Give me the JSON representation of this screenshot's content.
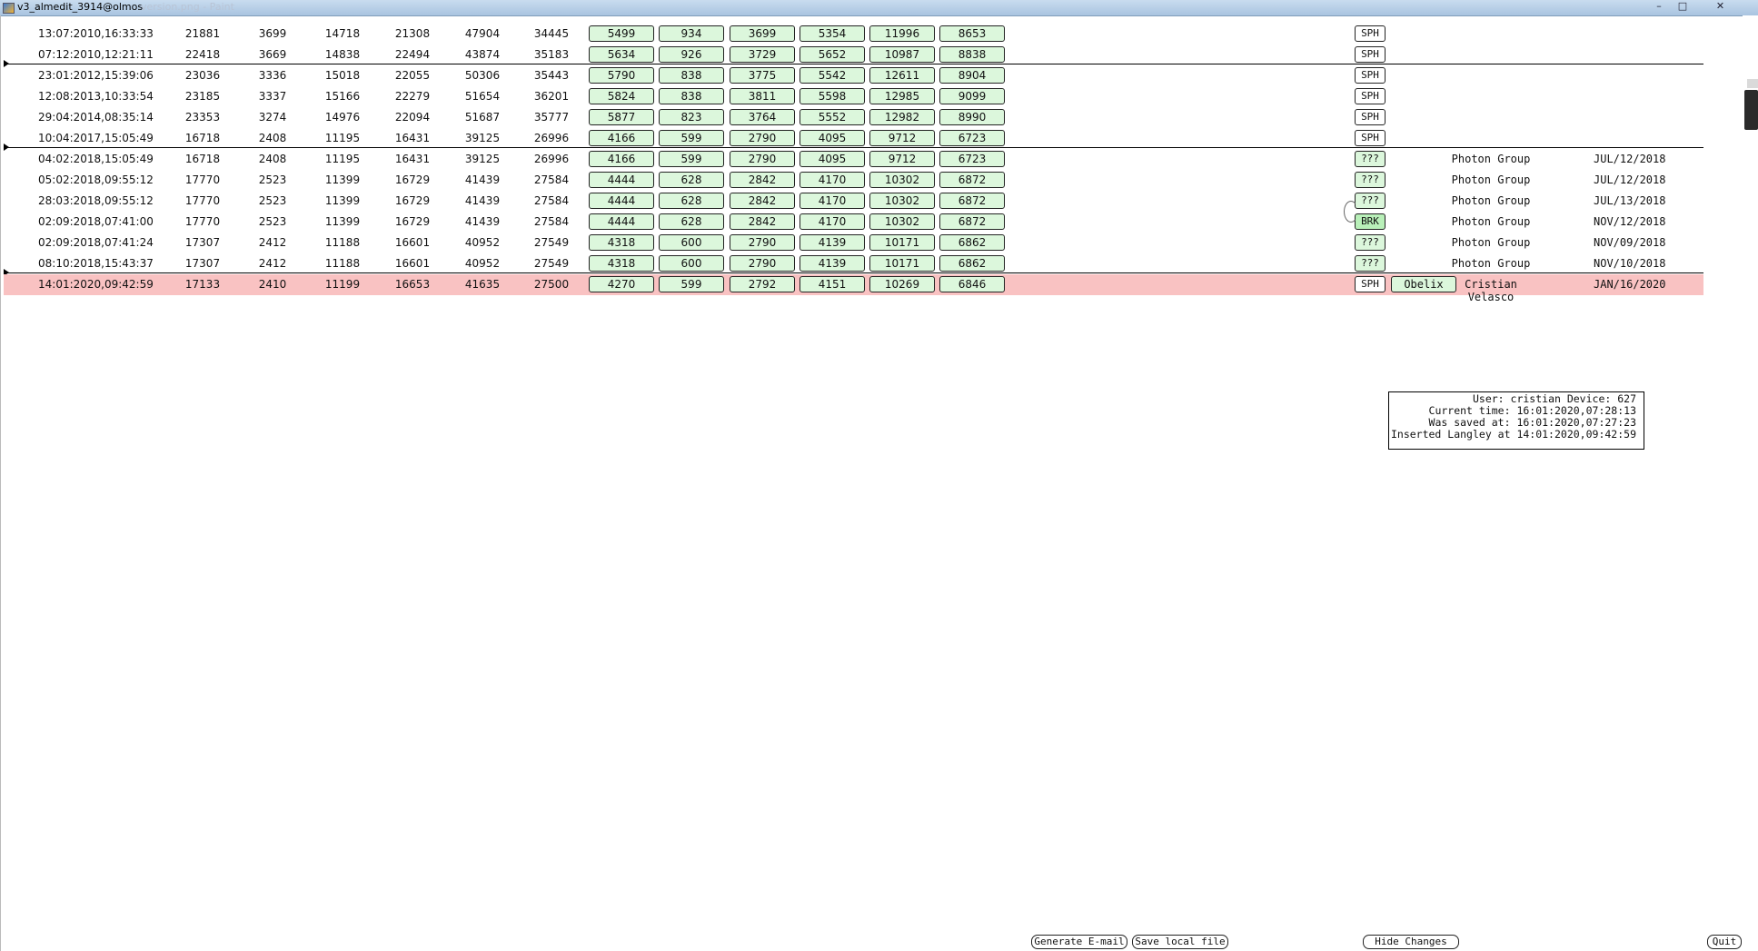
{
  "window": {
    "title": "v3_almedit_3914@olmos",
    "faded_title": "version.png - Paint",
    "buttons": [
      "–",
      "□",
      "✕"
    ]
  },
  "rows": [
    {
      "date": "13:07:2010,16:33:33",
      "nums": [
        "21881",
        "3699",
        "14718",
        "21308",
        "47904",
        "34445"
      ],
      "boxes": [
        "5499",
        "934",
        "3699",
        "5354",
        "11996",
        "8653"
      ],
      "status": "SPH",
      "group": "",
      "pdate": "",
      "sep_before": false
    },
    {
      "date": "07:12:2010,12:21:11",
      "nums": [
        "22418",
        "3669",
        "14838",
        "22494",
        "43874",
        "35183"
      ],
      "boxes": [
        "5634",
        "926",
        "3729",
        "5652",
        "10987",
        "8838"
      ],
      "status": "SPH",
      "group": "",
      "pdate": "",
      "sep_before": false
    },
    {
      "date": "23:01:2012,15:39:06",
      "nums": [
        "23036",
        "3336",
        "15018",
        "22055",
        "50306",
        "35443"
      ],
      "boxes": [
        "5790",
        "838",
        "3775",
        "5542",
        "12611",
        "8904"
      ],
      "status": "SPH",
      "group": "",
      "pdate": "",
      "sep_before": true
    },
    {
      "date": "12:08:2013,10:33:54",
      "nums": [
        "23185",
        "3337",
        "15166",
        "22279",
        "51654",
        "36201"
      ],
      "boxes": [
        "5824",
        "838",
        "3811",
        "5598",
        "12985",
        "9099"
      ],
      "status": "SPH",
      "group": "",
      "pdate": "",
      "sep_before": false
    },
    {
      "date": "29:04:2014,08:35:14",
      "nums": [
        "23353",
        "3274",
        "14976",
        "22094",
        "51687",
        "35777"
      ],
      "boxes": [
        "5877",
        "823",
        "3764",
        "5552",
        "12982",
        "8990"
      ],
      "status": "SPH",
      "group": "",
      "pdate": "",
      "sep_before": false
    },
    {
      "date": "10:04:2017,15:05:49",
      "nums": [
        "16718",
        "2408",
        "11195",
        "16431",
        "39125",
        "26996"
      ],
      "boxes": [
        "4166",
        "599",
        "2790",
        "4095",
        "9712",
        "6723"
      ],
      "status": "SPH",
      "group": "",
      "pdate": "",
      "sep_before": false
    },
    {
      "date": "04:02:2018,15:05:49",
      "nums": [
        "16718",
        "2408",
        "11195",
        "16431",
        "39125",
        "26996"
      ],
      "boxes": [
        "4166",
        "599",
        "2790",
        "4095",
        "9712",
        "6723"
      ],
      "status": "???",
      "group": "Photon Group",
      "pdate": "JUL/12/2018",
      "sep_before": true
    },
    {
      "date": "05:02:2018,09:55:12",
      "nums": [
        "17770",
        "2523",
        "11399",
        "16729",
        "41439",
        "27584"
      ],
      "boxes": [
        "4444",
        "628",
        "2842",
        "4170",
        "10302",
        "6872"
      ],
      "status": "???",
      "group": "Photon Group",
      "pdate": "JUL/12/2018",
      "sep_before": false
    },
    {
      "date": "28:03:2018,09:55:12",
      "nums": [
        "17770",
        "2523",
        "11399",
        "16729",
        "41439",
        "27584"
      ],
      "boxes": [
        "4444",
        "628",
        "2842",
        "4170",
        "10302",
        "6872"
      ],
      "status": "???",
      "group": "Photon Group",
      "pdate": "JUL/13/2018",
      "sep_before": false
    },
    {
      "date": "02:09:2018,07:41:00",
      "nums": [
        "17770",
        "2523",
        "11399",
        "16729",
        "41439",
        "27584"
      ],
      "boxes": [
        "4444",
        "628",
        "2842",
        "4170",
        "10302",
        "6872"
      ],
      "status": "BRK",
      "group": "Photon Group",
      "pdate": "NOV/12/2018",
      "sep_before": false
    },
    {
      "date": "02:09:2018,07:41:24",
      "nums": [
        "17307",
        "2412",
        "11188",
        "16601",
        "40952",
        "27549"
      ],
      "boxes": [
        "4318",
        "600",
        "2790",
        "4139",
        "10171",
        "6862"
      ],
      "status": "???",
      "group": "Photon Group",
      "pdate": "NOV/09/2018",
      "sep_before": false
    },
    {
      "date": "08:10:2018,15:43:37",
      "nums": [
        "17307",
        "2412",
        "11188",
        "16601",
        "40952",
        "27549"
      ],
      "boxes": [
        "4318",
        "600",
        "2790",
        "4139",
        "10171",
        "6862"
      ],
      "status": "???",
      "group": "Photon Group",
      "pdate": "NOV/10/2018",
      "sep_before": false
    },
    {
      "date": "14:01:2020,09:42:59",
      "nums": [
        "17133",
        "2410",
        "11199",
        "16653",
        "41635",
        "27500"
      ],
      "boxes": [
        "4270",
        "599",
        "2792",
        "4151",
        "10269",
        "6846"
      ],
      "status": "SPH",
      "obelix": "Obelix",
      "group": "Cristian Velasco",
      "pdate": "JAN/16/2020",
      "sep_before": true,
      "highlight": true
    }
  ],
  "info": {
    "line1": "User: cristian Device: 627",
    "line2": "Current time: 16:01:2020,07:28:13",
    "line3": "Was saved at: 16:01:2020,07:27:23",
    "line4": "Inserted Langley at 14:01:2020,09:42:59"
  },
  "buttons": {
    "generate_email": "Generate E-mail",
    "save_local": "Save local file",
    "hide_changes": "Hide Changes",
    "quit": "Quit"
  },
  "colors": {
    "cell_box": "#dcf7dc",
    "highlight_row": "#f9c2c2"
  }
}
